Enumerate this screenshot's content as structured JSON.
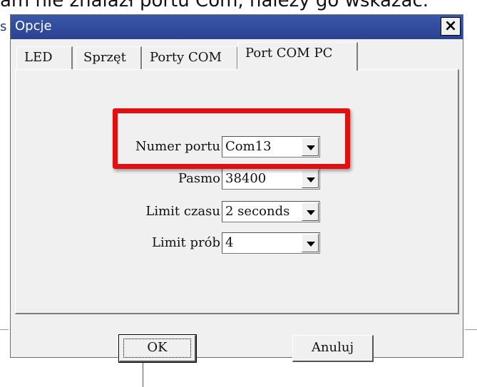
{
  "background": {
    "top_text": "am nie znalazł portu Com, należy go wskazać.",
    "left_fragment": "s"
  },
  "dialog": {
    "title": "Opcje",
    "close_symbol": "×"
  },
  "tabs": [
    {
      "label": "LED",
      "active": false
    },
    {
      "label": "Sprzęt",
      "active": false
    },
    {
      "label": "Porty COM",
      "active": false
    },
    {
      "label": "Port COM PC",
      "active": true
    }
  ],
  "form": {
    "port_number": {
      "label": "Numer portu",
      "value": "Com13"
    },
    "baud": {
      "label": "Pasmo",
      "value": "38400"
    },
    "timeout": {
      "label": "Limit czasu",
      "value": "2 seconds"
    },
    "retries": {
      "label": "Limit prób",
      "value": "4"
    }
  },
  "buttons": {
    "ok": "OK",
    "cancel": "Anuluj"
  },
  "colors": {
    "titlebar": "#2f4a9c",
    "highlight": "#e01010",
    "dialog_bg": "#f0f0f0"
  },
  "icons": {
    "close": "close-icon",
    "dropdown": "chevron-down-icon"
  }
}
